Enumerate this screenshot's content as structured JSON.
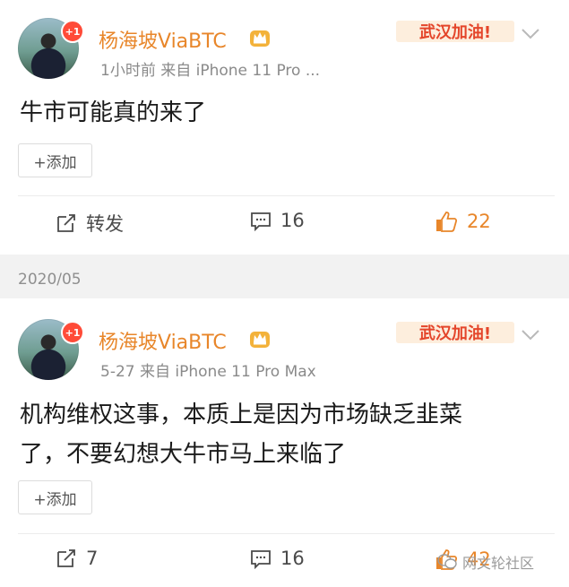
{
  "posts": [
    {
      "username": "杨海坡ViaBTC",
      "badge": "+1",
      "meta": "1小时前  来自 iPhone 11 Pro ...",
      "banner": "武汉加油!",
      "content": "牛市可能真的来了",
      "add_label": "+添加",
      "repost": "转发",
      "comments": "16",
      "likes": "22"
    },
    {
      "username": "杨海坡ViaBTC",
      "badge": "+1",
      "meta": "5-27  来自 iPhone 11 Pro Max",
      "banner": "武汉加油!",
      "content_line1": "机构维权这事，本质上是因为市场缺乏韭菜",
      "content_line2": "了，不要幻想大牛市马上来临了",
      "add_label": "+添加",
      "repost": "7",
      "comments": "16",
      "likes": "42"
    }
  ],
  "date_separator": "2020/05",
  "watermark": "网文轮社区",
  "colors": {
    "username": "#e8862a",
    "like_active": "#e8862a",
    "meta": "#8a8a8a",
    "separator_bg": "#f2f2f2",
    "badge": "#ff4b38"
  },
  "icons": [
    "crown-icon",
    "chevron-down-icon",
    "repost-icon",
    "comment-icon",
    "thumbs-up-icon",
    "wechat-icon"
  ]
}
